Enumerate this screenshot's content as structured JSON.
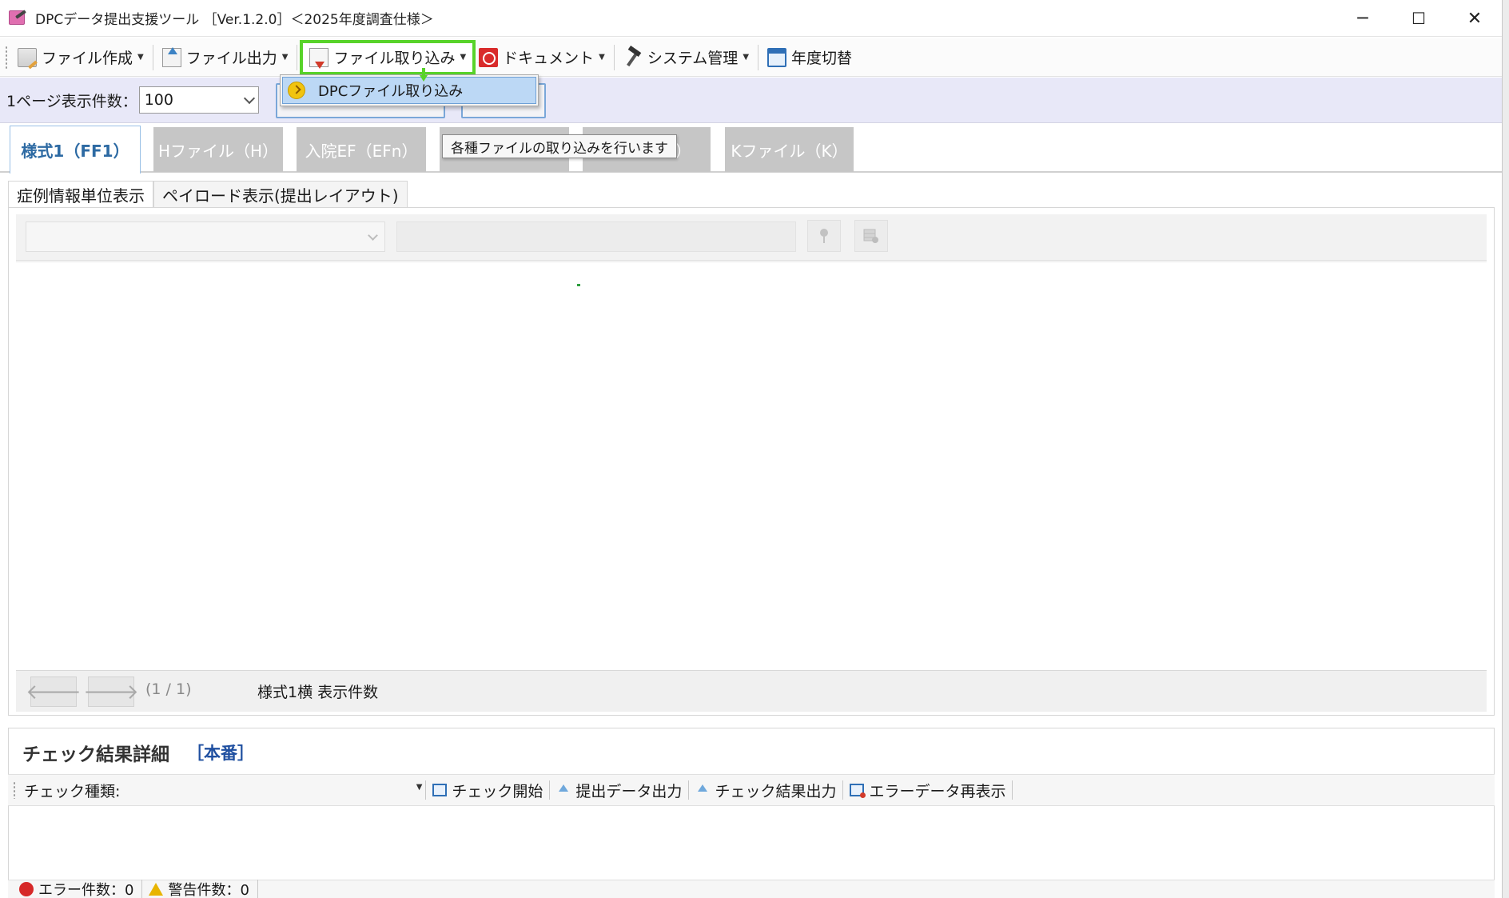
{
  "window": {
    "title": "DPCデータ提出支援ツール ［Ver.1.2.0］＜2025年度調査仕様＞",
    "minimize_glyph": "─",
    "maximize_glyph": "☐",
    "close_glyph": "✕"
  },
  "toolbar": {
    "items": [
      {
        "label": "ファイル作成",
        "icon": "file-create-icon"
      },
      {
        "label": "ファイル出力",
        "icon": "file-export-icon"
      },
      {
        "label": "ファイル取り込み",
        "icon": "file-import-icon"
      },
      {
        "label": "ドキュメント",
        "icon": "pdf-document-icon"
      },
      {
        "label": "システム管理",
        "icon": "hammer-icon"
      },
      {
        "label": "年度切替",
        "icon": "year-window-icon"
      }
    ],
    "highlight_color": "#58d32a"
  },
  "import_menu": {
    "items": [
      {
        "label": "DPCファイル取り込み",
        "icon": "arrow-circle-icon"
      }
    ]
  },
  "tooltip": {
    "text": "各種ファイルの取り込みを行います"
  },
  "options": {
    "page_size_label": "1ページ表示件数：",
    "page_size_value": "100"
  },
  "tabs": [
    {
      "label": "様式1（FF1）",
      "active": true
    },
    {
      "label": "Hファイル（H）",
      "active": false
    },
    {
      "label": "入院EF（EFn）",
      "active": false
    },
    {
      "label": "",
      "active": false
    },
    {
      "label": "FF3）",
      "active": false
    },
    {
      "label": "Kファイル（K）",
      "active": false
    }
  ],
  "subtabs": [
    {
      "label": "症例情報単位表示",
      "active": true
    },
    {
      "label": "ペイロード表示(提出レイアウト)",
      "active": false
    }
  ],
  "pager": {
    "prev_glyph": "🡐",
    "next_glyph": "🡒",
    "page_info": "(1 / 1)",
    "count_label": "様式1横  表示件数"
  },
  "check": {
    "title": "チェック結果詳細",
    "env": "［本番］",
    "type_label": "チェック種類:",
    "buttons": [
      {
        "label": "チェック開始",
        "icon": "check-start-icon"
      },
      {
        "label": "提出データ出力",
        "icon": "upload-icon"
      },
      {
        "label": "チェック結果出力",
        "icon": "upload-icon"
      },
      {
        "label": "エラーデータ再表示",
        "icon": "redisplay-icon"
      }
    ],
    "status": {
      "error_label": "エラー件数：0",
      "warning_label": "警告件数：0"
    }
  },
  "colors": {
    "active_tab_text": "#2d6aa3",
    "inactive_tab_bg": "#c6c6c6",
    "options_bar_bg": "#e8e8f8",
    "env_label": "#1f4fa0"
  }
}
